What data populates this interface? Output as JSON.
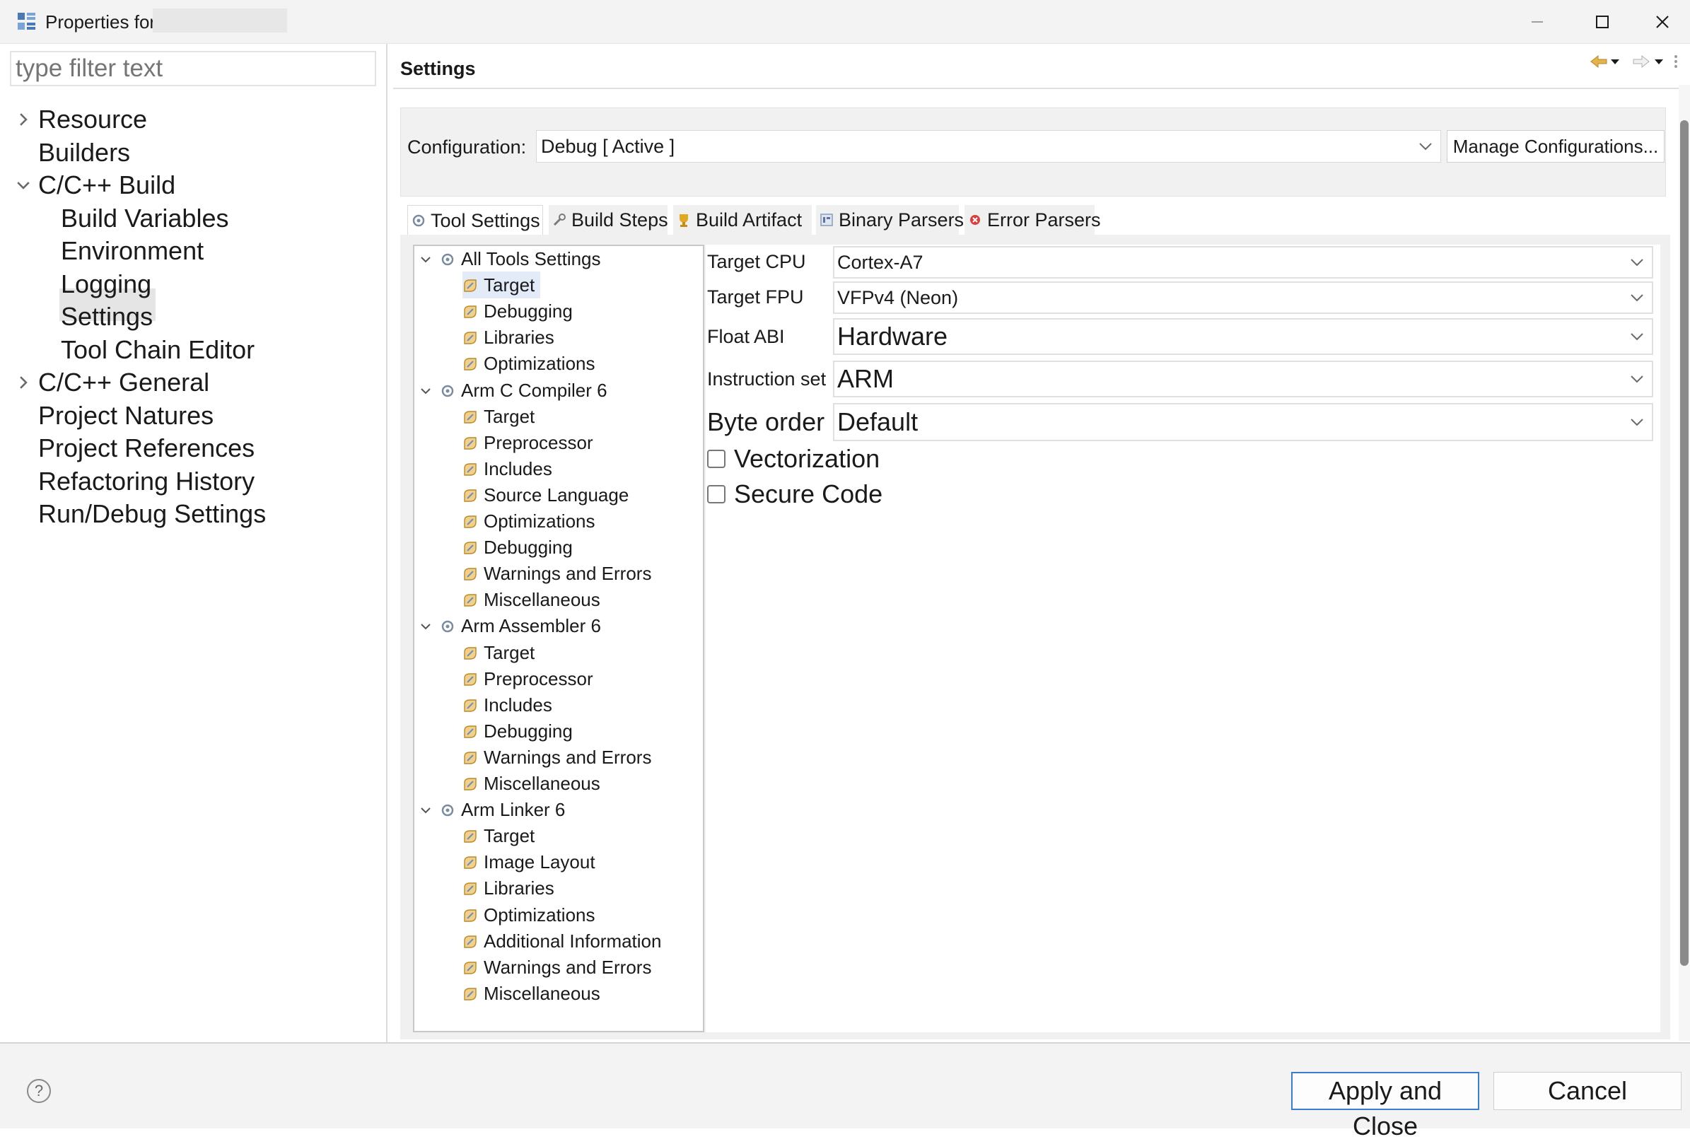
{
  "window": {
    "title": "Properties for",
    "minimize": "—",
    "maximize": "☐",
    "close": "✕"
  },
  "left": {
    "filter_placeholder": "type filter text",
    "items": [
      {
        "label": "Resource",
        "level": 0,
        "expander": "collapsed"
      },
      {
        "label": "Builders",
        "level": 0,
        "expander": "none"
      },
      {
        "label": "C/C++ Build",
        "level": 0,
        "expander": "expanded"
      },
      {
        "label": "Build Variables",
        "level": 1,
        "expander": "none"
      },
      {
        "label": "Environment",
        "level": 1,
        "expander": "none"
      },
      {
        "label": "Logging",
        "level": 1,
        "expander": "none"
      },
      {
        "label": "Settings",
        "level": 1,
        "expander": "none",
        "selected": true
      },
      {
        "label": "Tool Chain Editor",
        "level": 1,
        "expander": "none"
      },
      {
        "label": "C/C++ General",
        "level": 0,
        "expander": "collapsed"
      },
      {
        "label": "Project Natures",
        "level": 0,
        "expander": "none"
      },
      {
        "label": "Project References",
        "level": 0,
        "expander": "none"
      },
      {
        "label": "Refactoring History",
        "level": 0,
        "expander": "none"
      },
      {
        "label": "Run/Debug Settings",
        "level": 0,
        "expander": "none"
      }
    ]
  },
  "main": {
    "title": "Settings",
    "config_label": "Configuration:",
    "config_value": "Debug  [ Active ]",
    "manage_label": "Manage Configurations...",
    "tabs": [
      {
        "label": "Tool Settings",
        "icon": "gear-icon",
        "active": true
      },
      {
        "label": "Build Steps",
        "icon": "wrench-icon",
        "active": false
      },
      {
        "label": "Build Artifact",
        "icon": "trophy-icon",
        "active": false
      },
      {
        "label": "Binary Parsers",
        "icon": "binary-icon",
        "active": false
      },
      {
        "label": "Error Parsers",
        "icon": "error-icon",
        "active": false
      }
    ],
    "tree": [
      {
        "label": "All Tools Settings",
        "level": 0,
        "group": true
      },
      {
        "label": "Target",
        "level": 1,
        "selected": true
      },
      {
        "label": "Debugging",
        "level": 1
      },
      {
        "label": "Libraries",
        "level": 1
      },
      {
        "label": "Optimizations",
        "level": 1
      },
      {
        "label": "Arm C Compiler 6",
        "level": 0,
        "group": true
      },
      {
        "label": "Target",
        "level": 1
      },
      {
        "label": "Preprocessor",
        "level": 1
      },
      {
        "label": "Includes",
        "level": 1
      },
      {
        "label": "Source Language",
        "level": 1
      },
      {
        "label": "Optimizations",
        "level": 1
      },
      {
        "label": "Debugging",
        "level": 1
      },
      {
        "label": "Warnings and Errors",
        "level": 1
      },
      {
        "label": "Miscellaneous",
        "level": 1
      },
      {
        "label": "Arm Assembler 6",
        "level": 0,
        "group": true
      },
      {
        "label": "Target",
        "level": 1
      },
      {
        "label": "Preprocessor",
        "level": 1
      },
      {
        "label": "Includes",
        "level": 1
      },
      {
        "label": "Debugging",
        "level": 1
      },
      {
        "label": "Warnings and Errors",
        "level": 1
      },
      {
        "label": "Miscellaneous",
        "level": 1
      },
      {
        "label": "Arm Linker 6",
        "level": 0,
        "group": true
      },
      {
        "label": "Target",
        "level": 1
      },
      {
        "label": "Image Layout",
        "level": 1
      },
      {
        "label": "Libraries",
        "level": 1
      },
      {
        "label": "Optimizations",
        "level": 1
      },
      {
        "label": "Additional Information",
        "level": 1
      },
      {
        "label": "Warnings and Errors",
        "level": 1
      },
      {
        "label": "Miscellaneous",
        "level": 1
      }
    ],
    "options": {
      "target_cpu_label": "Target CPU",
      "target_cpu_value": "Cortex-A7",
      "target_fpu_label": "Target FPU",
      "target_fpu_value": "VFPv4 (Neon)",
      "float_abi_label": "Float ABI",
      "float_abi_value": "Hardware",
      "instruction_set_label": "Instruction set",
      "instruction_set_value": "ARM",
      "byte_order_label": "Byte order",
      "byte_order_value": "Default",
      "vectorization_label": "Vectorization",
      "vectorization_checked": false,
      "secure_code_label": "Secure Code",
      "secure_code_checked": false
    }
  },
  "footer": {
    "help": "?",
    "apply_label": "Apply and Close",
    "cancel_label": "Cancel"
  },
  "colors": {
    "accent": "#3b7bd0",
    "selection": "#e3ebf8",
    "nav_selection": "#e5e5e5",
    "icon_gold": "#d9a325",
    "icon_blue": "#4a78b8",
    "error_red": "#d93f3f"
  }
}
